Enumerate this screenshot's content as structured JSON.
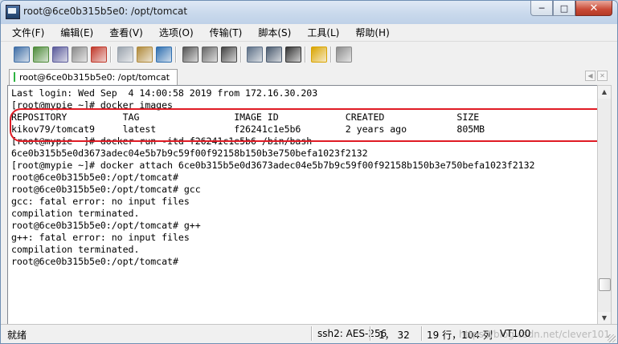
{
  "window": {
    "title": "root@6ce0b315b5e0: /opt/tomcat",
    "minimize_glyph": "─",
    "maximize_glyph": "□",
    "close_glyph": "✕"
  },
  "menu": [
    {
      "label": "文件(F)"
    },
    {
      "label": "编辑(E)"
    },
    {
      "label": "查看(V)"
    },
    {
      "label": "选项(O)"
    },
    {
      "label": "传输(T)"
    },
    {
      "label": "脚本(S)"
    },
    {
      "label": "工具(L)"
    },
    {
      "label": "帮助(H)"
    }
  ],
  "toolbar": [
    {
      "name": "connect-icon",
      "color": "#3f6ea6"
    },
    {
      "name": "quick-connect-icon",
      "color": "#4e8b3a"
    },
    {
      "name": "connect-in-tab-icon",
      "color": "#5a5a9a"
    },
    {
      "name": "reconnect-icon",
      "color": "#8a8a8a"
    },
    {
      "name": "disconnect-icon",
      "color": "#c0392b"
    },
    {
      "name": "copy-icon",
      "color": "#9aa3ad"
    },
    {
      "name": "paste-icon",
      "color": "#b08a3c"
    },
    {
      "name": "find-icon",
      "color": "#2f6fb0"
    },
    {
      "name": "print-setup-icon",
      "color": "#555555"
    },
    {
      "name": "print-icon",
      "color": "#666666"
    },
    {
      "name": "print-screen-icon",
      "color": "#444444"
    },
    {
      "name": "session-options-icon",
      "color": "#5c6f86"
    },
    {
      "name": "global-options-icon",
      "color": "#4a5a6e"
    },
    {
      "name": "keymap-icon",
      "color": "#333333"
    },
    {
      "name": "help-icon",
      "color": "#d9a400"
    },
    {
      "name": "sftp-icon",
      "color": "#8b8b8b"
    }
  ],
  "tab": {
    "label": "root@6ce0b315b5e0: /opt/tomcat"
  },
  "terminal": {
    "lines": [
      "Last login: Wed Sep  4 14:00:58 2019 from 172.16.30.203",
      "[root@mypie ~]# docker images",
      "REPOSITORY          TAG                 IMAGE ID            CREATED             SIZE",
      "kikov79/tomcat9     latest              f26241c1e5b6        2 years ago         805MB",
      "[root@mypie ~]# docker run -itd f26241c1e5b6 /bin/bash",
      "6ce0b315b5e0d3673adec04e5b7b9c59f00f92158b150b3e750befa1023f2132",
      "[root@mypie ~]# docker attach 6ce0b315b5e0d3673adec04e5b7b9c59f00f92158b150b3e750befa1023f2132",
      "root@6ce0b315b5e0:/opt/tomcat#",
      "root@6ce0b315b5e0:/opt/tomcat# gcc",
      "gcc: fatal error: no input files",
      "compilation terminated.",
      "root@6ce0b315b5e0:/opt/tomcat# g++",
      "g++: fatal error: no input files",
      "compilation terminated.",
      "root@6ce0b315b5e0:/opt/tomcat#"
    ],
    "highlight_color": "#e01b24"
  },
  "status": {
    "ready": "就绪",
    "encryption": "ssh2: AES-256",
    "cursor_pos": "1， 32",
    "dimensions": "19 行，104 列",
    "terminal_type": "VT100",
    "watermark": "https://blog.csdn.net/clever101"
  }
}
